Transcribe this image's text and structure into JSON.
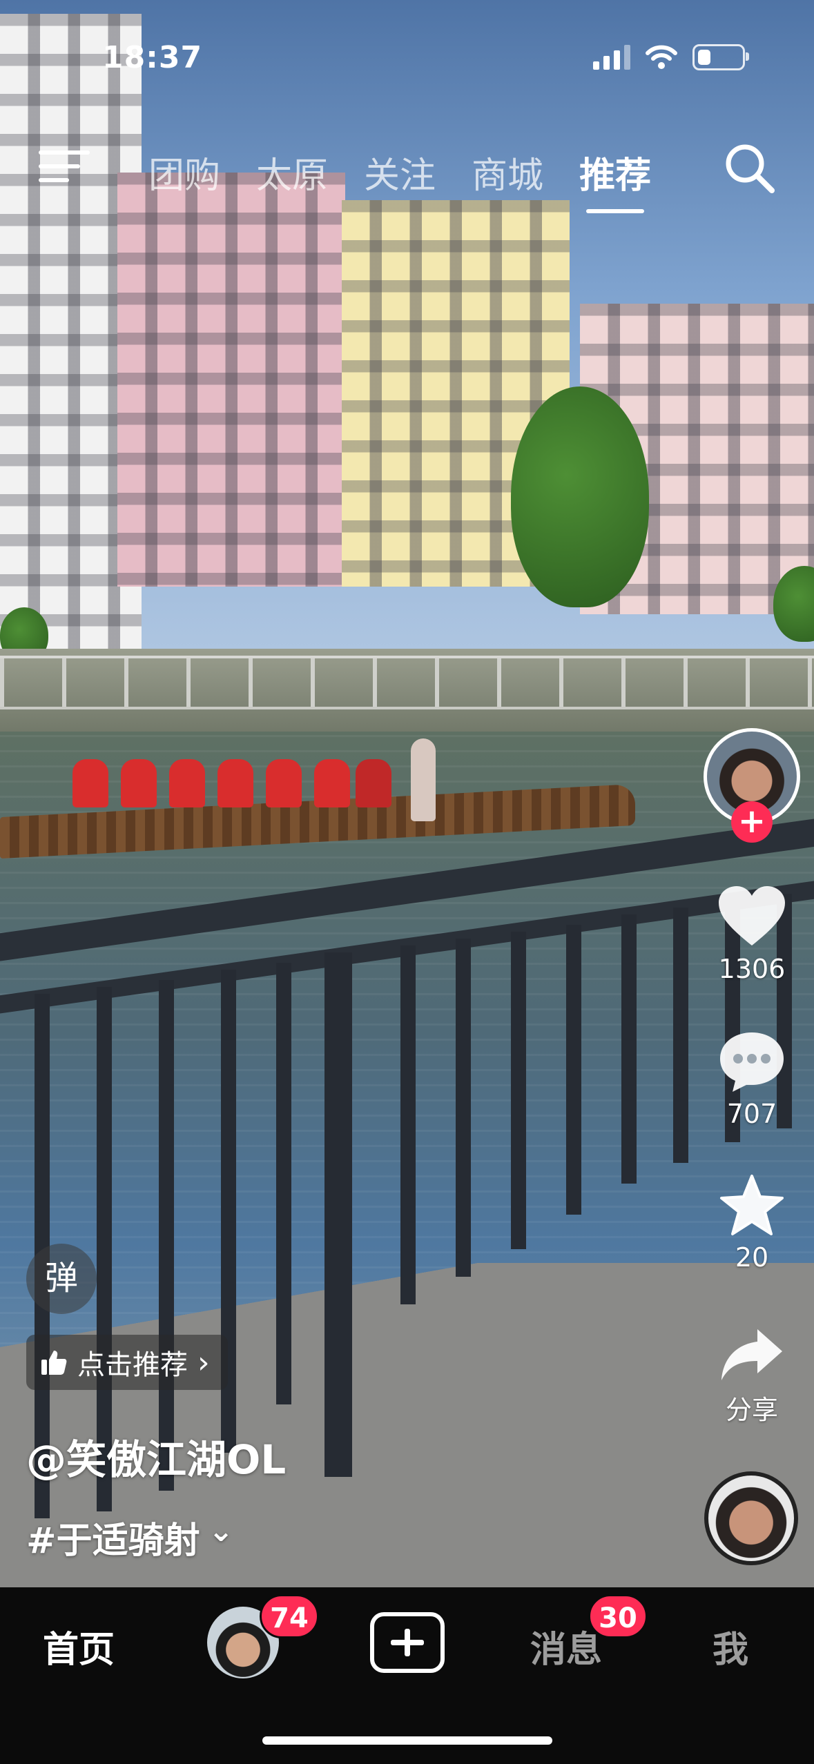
{
  "status_bar": {
    "time": "18:37",
    "icons": [
      "signal-icon",
      "wifi-icon",
      "battery-icon"
    ]
  },
  "top_nav": {
    "menu_icon": "menu-icon",
    "tabs": [
      {
        "label": "团购",
        "active": false
      },
      {
        "label": "太原",
        "active": false
      },
      {
        "label": "关注",
        "active": false
      },
      {
        "label": "商城",
        "active": false
      },
      {
        "label": "推荐",
        "active": true
      }
    ],
    "search_icon": "search-icon"
  },
  "right_rail": {
    "follow_symbol": "+",
    "like_count": "1306",
    "comment_count": "707",
    "favorite_count": "20",
    "share_label": "分享"
  },
  "overlay": {
    "danmu_label": "弹",
    "recommend_label": "点击推荐",
    "recommend_chevron": "›",
    "author": "@笑傲江湖OL",
    "hashtag": "#于适骑射",
    "hashtag_chevron": "⌄"
  },
  "bottom_tabs": {
    "home": "首页",
    "friend_badge": "74",
    "messages": "消息",
    "messages_badge": "30",
    "me": "我"
  },
  "colors": {
    "accent": "#fe2c55",
    "tabbar_bg": "#0b0b0b"
  }
}
